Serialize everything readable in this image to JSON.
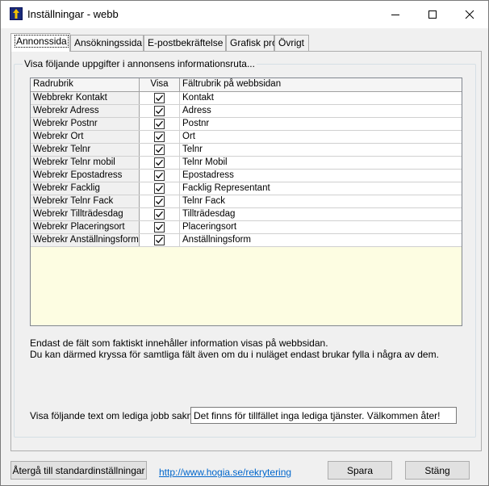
{
  "window": {
    "title": "Inställningar - webb",
    "controls": {
      "minimize": "—",
      "maximize": "☐",
      "close": "✕"
    }
  },
  "tabs": [
    {
      "label": "Annonssida",
      "active": true
    },
    {
      "label": "Ansökningssida",
      "active": false
    },
    {
      "label": "E-postbekräftelse",
      "active": false
    },
    {
      "label": "Grafisk profil",
      "active": false
    },
    {
      "label": "Övrigt",
      "active": false
    }
  ],
  "group": {
    "legend": "Visa följande uppgifter i annonsens informationsruta..."
  },
  "grid": {
    "columns": [
      "Radrubrik",
      "Visa",
      "Fältrubrik på webbsidan"
    ],
    "rows": [
      {
        "rubrik": "Webbrekr Kontakt",
        "visa": true,
        "falt": "Kontakt"
      },
      {
        "rubrik": "Webrekr Adress",
        "visa": true,
        "falt": "Adress"
      },
      {
        "rubrik": "Webrekr Postnr",
        "visa": true,
        "falt": "Postnr"
      },
      {
        "rubrik": "Webrekr Ort",
        "visa": true,
        "falt": "Ort"
      },
      {
        "rubrik": "Webrekr Telnr",
        "visa": true,
        "falt": "Telnr"
      },
      {
        "rubrik": "Webrekr Telnr mobil",
        "visa": true,
        "falt": "Telnr Mobil"
      },
      {
        "rubrik": "Webrekr Epostadress",
        "visa": true,
        "falt": "Epostadress"
      },
      {
        "rubrik": "Webrekr Facklig",
        "visa": true,
        "falt": "Facklig Representant"
      },
      {
        "rubrik": "Webrekr Telnr Fack",
        "visa": true,
        "falt": "Telnr Fack"
      },
      {
        "rubrik": "Webrekr Tillträdesdag",
        "visa": true,
        "falt": "Tillträdesdag"
      },
      {
        "rubrik": "Webrekr Placeringsort",
        "visa": true,
        "falt": "Placeringsort"
      },
      {
        "rubrik": "Webrekr Anställningsform",
        "visa": true,
        "falt": "Anställningsform"
      }
    ]
  },
  "info": {
    "line1": "Endast de fält som faktiskt innehåller information visas på webbsidan.",
    "line2": "Du kan därmed kryssa för samtliga fält även om du i nuläget endast brukar fylla i några av dem."
  },
  "nojobs": {
    "label": "Visa följande text om lediga jobb saknas:",
    "value": "Det finns för tillfället inga lediga tjänster. Välkommen åter!"
  },
  "footer": {
    "reset_label": "Återgå till standardinställningar",
    "link_text": "http://www.hogia.se/rekrytering",
    "save_label": "Spara",
    "close_label": "Stäng"
  },
  "colors": {
    "grid_empty_bg": "#fdfde2",
    "link": "#0066cc"
  }
}
